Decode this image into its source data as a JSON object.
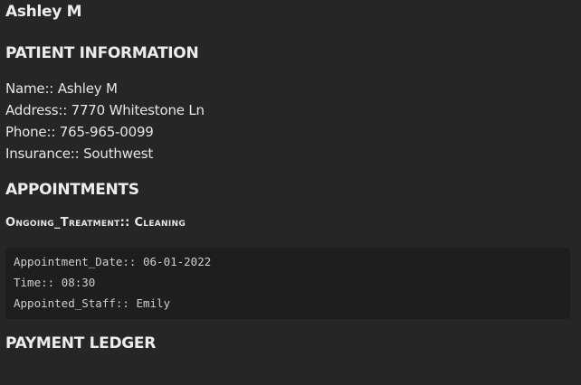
{
  "document": {
    "title": "Ashley M"
  },
  "patient_section": {
    "heading": "PATIENT INFORMATION",
    "fields": [
      {
        "label": "Name::",
        "value": "Ashley M"
      },
      {
        "label": "Address::",
        "value": "7770 Whitestone Ln"
      },
      {
        "label": "Phone::",
        "value": "765-965-0099"
      },
      {
        "label": "Insurance::",
        "value": "Southwest"
      }
    ]
  },
  "appointments_section": {
    "heading": "APPOINTMENTS",
    "ongoing_treatment": {
      "label": "Ongoing_Treatment::",
      "value": "Cleaning"
    },
    "code_lines": [
      {
        "label": "Appointment_Date::",
        "value": "06-01-2022"
      },
      {
        "label": "Time::",
        "value": "08:30"
      },
      {
        "label": "Appointed_Staff::",
        "value": "Emily"
      }
    ]
  },
  "payment_section": {
    "heading": "PAYMENT LEDGER"
  }
}
